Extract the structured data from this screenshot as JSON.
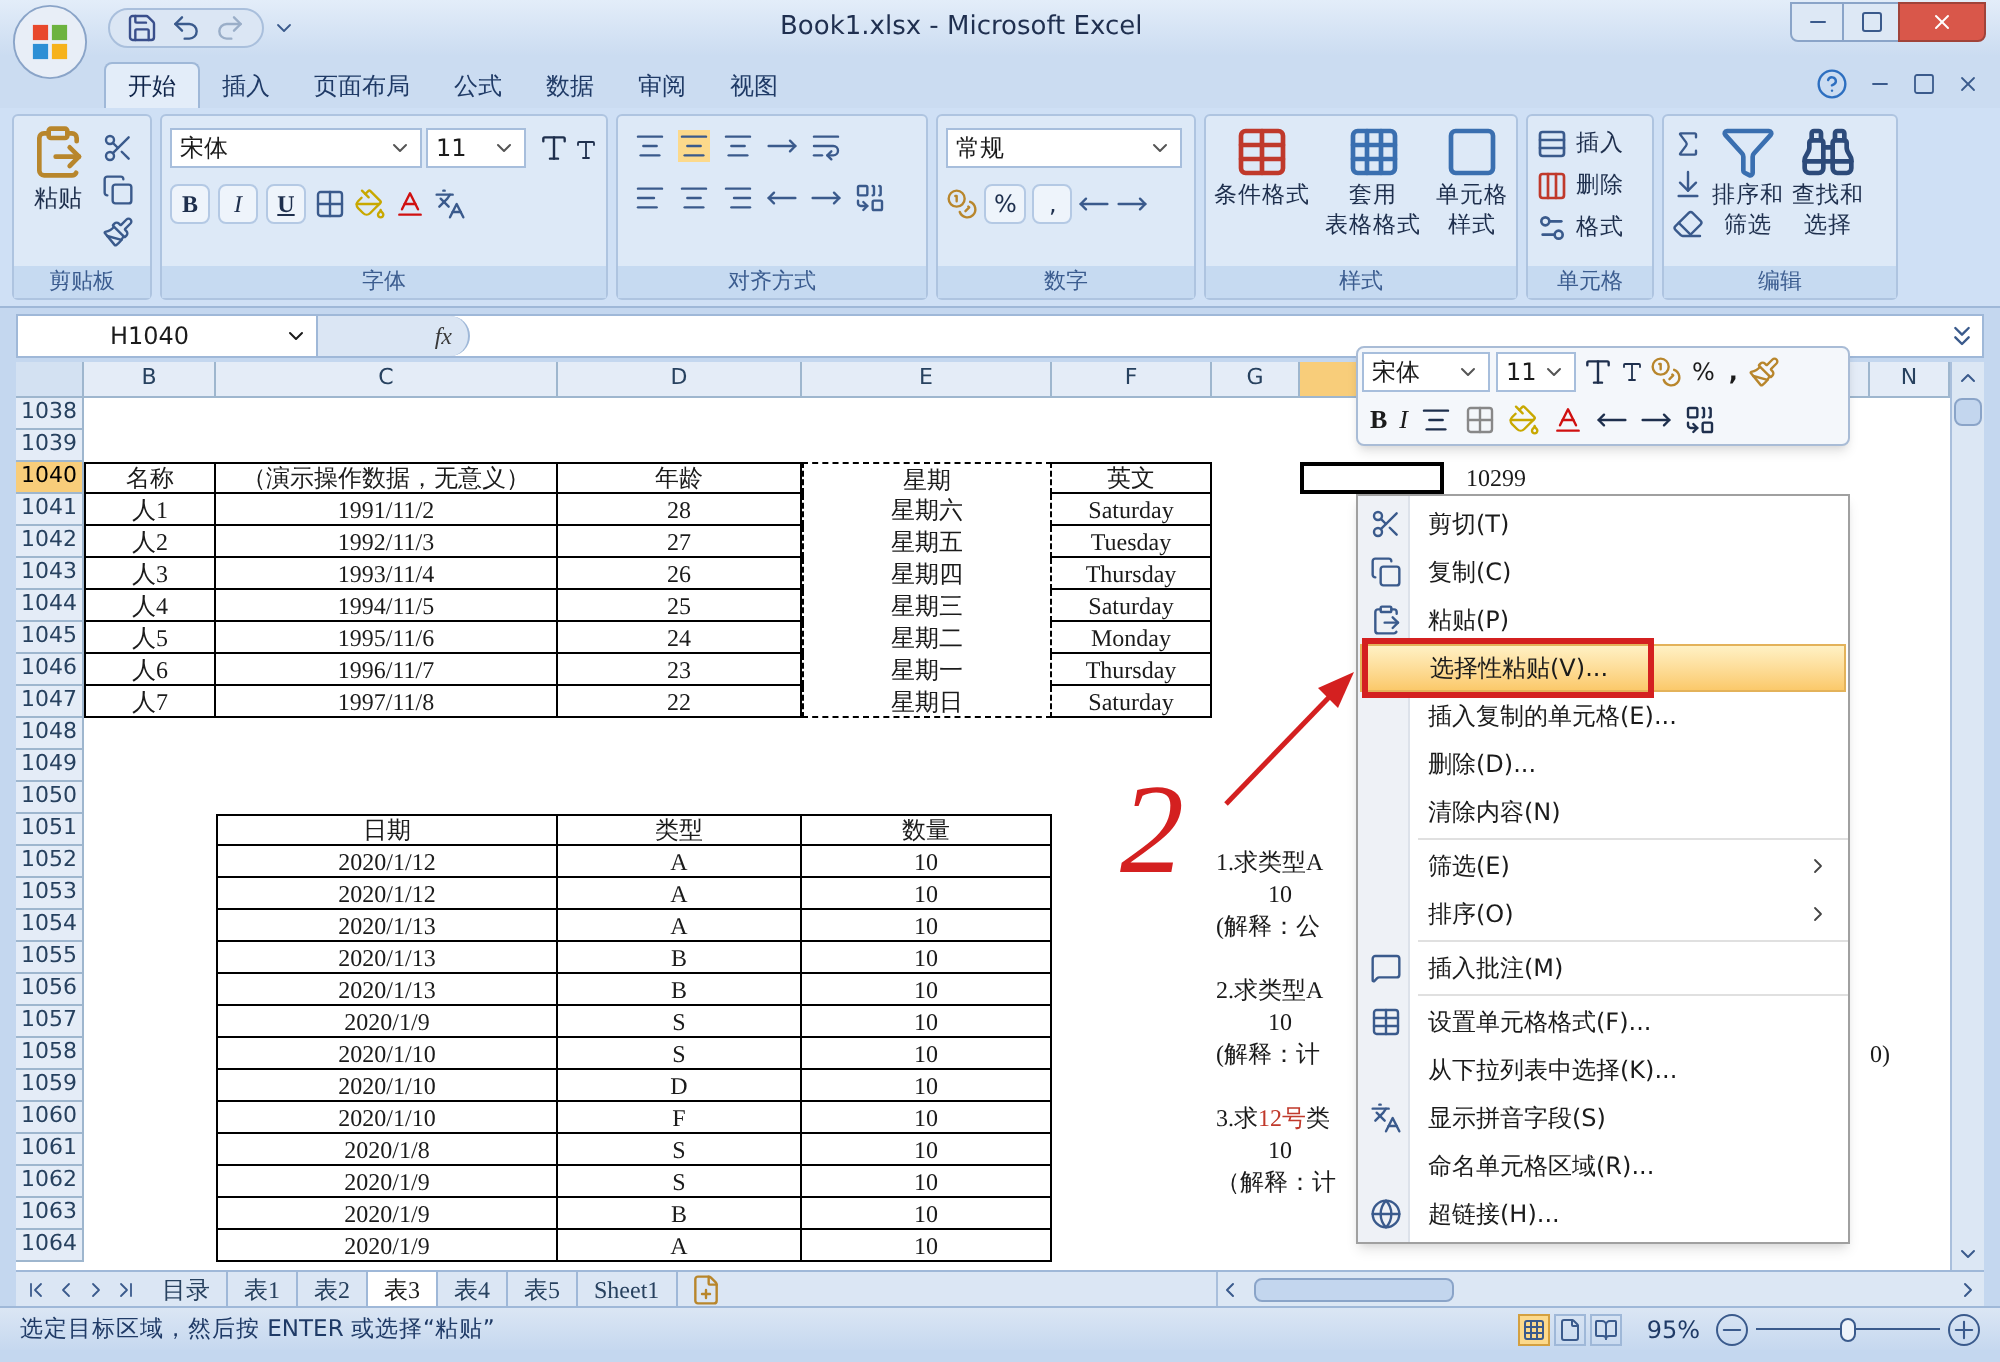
{
  "window": {
    "title": "Book1.xlsx - Microsoft Excel"
  },
  "ribbon_tabs": [
    {
      "label": "开始",
      "selected": true
    },
    {
      "label": "插入",
      "selected": false
    },
    {
      "label": "页面布局",
      "selected": false
    },
    {
      "label": "公式",
      "selected": false
    },
    {
      "label": "数据",
      "selected": false
    },
    {
      "label": "审阅",
      "selected": false
    },
    {
      "label": "视图",
      "selected": false
    }
  ],
  "ribbon": {
    "clipboard": {
      "label": "剪贴板",
      "paste": "粘贴"
    },
    "font": {
      "label": "字体",
      "font_name": "宋体",
      "font_size": "11",
      "bold": "B",
      "italic": "I",
      "underline": "U"
    },
    "alignment": {
      "label": "对齐方式"
    },
    "number": {
      "label": "数字",
      "format": "常规",
      "percent": "%",
      "comma": ","
    },
    "styles": {
      "label": "样式",
      "buttons": [
        [
          "条件格式"
        ],
        [
          "套用",
          "表格格式"
        ],
        [
          "单元格",
          "样式"
        ]
      ]
    },
    "cells": {
      "label": "单元格",
      "buttons": [
        "插入",
        "删除",
        "格式"
      ]
    },
    "editing": {
      "label": "编辑",
      "buttons": [
        [
          "排序和",
          "筛选"
        ],
        [
          "查找和",
          "选择"
        ]
      ]
    }
  },
  "formula_bar": {
    "name_box": "H1040",
    "fx": "fx"
  },
  "columns": [
    {
      "label": "B",
      "selected": false
    },
    {
      "label": "C",
      "selected": false
    },
    {
      "label": "D",
      "selected": false
    },
    {
      "label": "E",
      "selected": false
    },
    {
      "label": "F",
      "selected": false
    },
    {
      "label": "G",
      "selected": false
    },
    {
      "selected": true
    },
    {
      "label": "N",
      "selected": false
    }
  ],
  "rows": [
    {
      "number": "1038",
      "selected": false
    },
    {
      "number": "1039",
      "selected": false
    },
    {
      "number": "1040",
      "selected": true,
      "copied": true,
      "table1": [
        "名称",
        "（演示操作数据，无意义）",
        "年龄",
        "星期",
        "英文"
      ],
      "right_text": {
        "text": "10299",
        "kind": "near"
      }
    },
    {
      "number": "1041",
      "selected": false,
      "copied": true,
      "table1": [
        "人1",
        "1991/11/2",
        "28",
        "星期六",
        "Saturday"
      ]
    },
    {
      "number": "1042",
      "selected": false,
      "copied": true,
      "table1": [
        "人2",
        "1992/11/3",
        "27",
        "星期五",
        "Tuesday"
      ]
    },
    {
      "number": "1043",
      "selected": false,
      "copied": true,
      "table1": [
        "人3",
        "1993/11/4",
        "26",
        "星期四",
        "Thursday"
      ]
    },
    {
      "number": "1044",
      "selected": false,
      "copied": true,
      "table1": [
        "人4",
        "1994/11/5",
        "25",
        "星期三",
        "Saturday"
      ]
    },
    {
      "number": "1045",
      "selected": false,
      "copied": true,
      "table1": [
        "人5",
        "1995/11/6",
        "24",
        "星期二",
        "Monday"
      ]
    },
    {
      "number": "1046",
      "selected": false,
      "copied": true,
      "table1": [
        "人6",
        "1996/11/7",
        "23",
        "星期一",
        "Thursday"
      ]
    },
    {
      "number": "1047",
      "selected": false,
      "copied": true,
      "table1": [
        "人7",
        "1997/11/8",
        "22",
        "星期日",
        "Saturday"
      ]
    },
    {
      "number": "1048",
      "selected": false
    },
    {
      "number": "1049",
      "selected": false
    },
    {
      "number": "1050",
      "selected": false
    },
    {
      "number": "1051",
      "selected": false,
      "table2": [
        "日期",
        "类型",
        "数量"
      ]
    },
    {
      "number": "1052",
      "selected": false,
      "table2": [
        "2020/1/12",
        "A",
        "10"
      ],
      "note": {
        "parts": [
          {
            "text": "1.求类型A",
            "red": false
          }
        ],
        "indented": false
      }
    },
    {
      "number": "1053",
      "selected": false,
      "table2": [
        "2020/1/12",
        "A",
        "10"
      ],
      "note": {
        "parts": [
          {
            "text": "10",
            "red": false
          }
        ],
        "indented": true
      }
    },
    {
      "number": "1054",
      "selected": false,
      "table2": [
        "2020/1/13",
        "A",
        "10"
      ],
      "note": {
        "parts": [
          {
            "text": "(解释：公",
            "red": false
          }
        ],
        "indented": false
      }
    },
    {
      "number": "1055",
      "selected": false,
      "table2": [
        "2020/1/13",
        "B",
        "10"
      ]
    },
    {
      "number": "1056",
      "selected": false,
      "table2": [
        "2020/1/13",
        "B",
        "10"
      ],
      "note": {
        "parts": [
          {
            "text": "2.求类型A",
            "red": false
          }
        ],
        "indented": false
      }
    },
    {
      "number": "1057",
      "selected": false,
      "table2": [
        "2020/1/9",
        "S",
        "10"
      ],
      "note": {
        "parts": [
          {
            "text": "10",
            "red": false
          }
        ],
        "indented": true
      }
    },
    {
      "number": "1058",
      "selected": false,
      "table2": [
        "2020/1/10",
        "S",
        "10"
      ],
      "note": {
        "parts": [
          {
            "text": "(解释：计",
            "red": false
          }
        ],
        "indented": false
      },
      "right_text": {
        "text": "0)",
        "kind": "far"
      }
    },
    {
      "number": "1059",
      "selected": false,
      "table2": [
        "2020/1/10",
        "D",
        "10"
      ]
    },
    {
      "number": "1060",
      "selected": false,
      "table2": [
        "2020/1/10",
        "F",
        "10"
      ],
      "note": {
        "parts": [
          {
            "text": "3.求",
            "red": false
          },
          {
            "text": "12号",
            "red": true
          },
          {
            "text": "类",
            "red": false
          }
        ],
        "indented": false
      }
    },
    {
      "number": "1061",
      "selected": false,
      "table2": [
        "2020/1/8",
        "S",
        "10"
      ],
      "note": {
        "parts": [
          {
            "text": "10",
            "red": false
          }
        ],
        "indented": true
      }
    },
    {
      "number": "1062",
      "selected": false,
      "table2": [
        "2020/1/9",
        "S",
        "10"
      ],
      "note": {
        "parts": [
          {
            "text": "（解释：计",
            "red": false
          }
        ],
        "indented": false
      }
    },
    {
      "number": "1063",
      "selected": false,
      "table2": [
        "2020/1/9",
        "B",
        "10"
      ]
    },
    {
      "number": "1064",
      "selected": false,
      "table2": [
        "2020/1/9",
        "A",
        "10"
      ]
    }
  ],
  "mini_toolbar": {
    "font_name": "宋体",
    "font_size": "11",
    "percent": "%",
    "comma": ",",
    "bold": "B",
    "italic": "I"
  },
  "context_menu": {
    "items": [
      {
        "label": "剪切(T)",
        "selected": false,
        "submenu": false,
        "separator_after": false
      },
      {
        "label": "复制(C)",
        "selected": false,
        "submenu": false,
        "separator_after": false
      },
      {
        "label": "粘贴(P)",
        "selected": false,
        "submenu": false,
        "separator_after": false
      },
      {
        "label": "选择性粘贴(V)...",
        "selected": true,
        "submenu": false,
        "separator_after": false
      },
      {
        "label": "插入复制的单元格(E)...",
        "selected": false,
        "submenu": false,
        "separator_after": false
      },
      {
        "label": "删除(D)...",
        "selected": false,
        "submenu": false,
        "separator_after": false
      },
      {
        "label": "清除内容(N)",
        "selected": false,
        "submenu": false,
        "separator_after": true
      },
      {
        "label": "筛选(E)",
        "selected": false,
        "submenu": true,
        "separator_after": false
      },
      {
        "label": "排序(O)",
        "selected": false,
        "submenu": true,
        "separator_after": true
      },
      {
        "label": "插入批注(M)",
        "selected": false,
        "submenu": false,
        "separator_after": true
      },
      {
        "label": "设置单元格格式(F)...",
        "selected": false,
        "submenu": false,
        "separator_after": false
      },
      {
        "label": "从下拉列表中选择(K)...",
        "selected": false,
        "submenu": false,
        "separator_after": false
      },
      {
        "label": "显示拼音字段(S)",
        "selected": false,
        "submenu": false,
        "separator_after": false
      },
      {
        "label": "命名单元格区域(R)...",
        "selected": false,
        "submenu": false,
        "separator_after": false
      },
      {
        "label": "超链接(H)...",
        "selected": false,
        "submenu": false,
        "separator_after": false
      }
    ]
  },
  "annotation": {
    "label": "2"
  },
  "sheet_tabs": [
    {
      "label": "目录",
      "selected": false
    },
    {
      "label": "表1",
      "selected": false
    },
    {
      "label": "表2",
      "selected": false
    },
    {
      "label": "表3",
      "selected": true
    },
    {
      "label": "表4",
      "selected": false
    },
    {
      "label": "表5",
      "selected": false
    },
    {
      "label": "Sheet1",
      "selected": false
    }
  ],
  "status_bar": {
    "message": "选定目标区域，然后按 ENTER 或选择“粘贴”",
    "views": [
      {
        "selected": true
      },
      {
        "selected": false
      },
      {
        "selected": false
      }
    ],
    "zoom": "95%",
    "zoom_slider": {
      "level": 0.5
    }
  }
}
